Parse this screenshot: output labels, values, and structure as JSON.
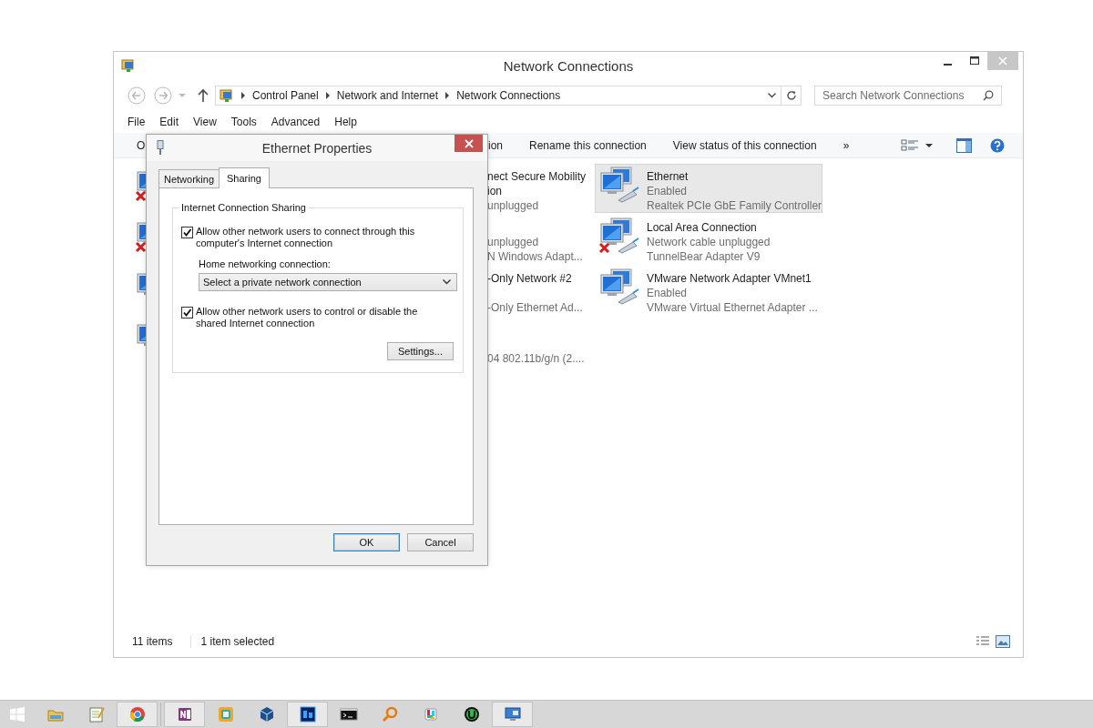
{
  "window": {
    "title": "Network Connections"
  },
  "address_bar": {
    "nav": [
      {
        "kind": "back",
        "disabled": true
      },
      {
        "kind": "forward",
        "disabled": true
      },
      {
        "kind": "recent",
        "disabled": true
      },
      {
        "kind": "up",
        "disabled": false
      }
    ],
    "breadcrumbs": [
      "Control Panel",
      "Network and Internet",
      "Network Connections"
    ],
    "search": {
      "placeholder": "Search Network Connections"
    }
  },
  "menu": [
    "File",
    "Edit",
    "View",
    "Tools",
    "Advanced",
    "Help"
  ],
  "toolbar": {
    "left": "O",
    "items": [
      "ion",
      "Rename this connection",
      "View status of this connection"
    ],
    "overflow": "»"
  },
  "adapter_column_1": [
    {
      "disconnected": true,
      "name": [
        "nect Secure Mobility",
        "ion"
      ],
      "status": "unplugged"
    },
    {
      "disconnected": true,
      "status": "unplugged",
      "device": "N Windows Adapt..."
    },
    {
      "disconnected": false,
      "name": [
        "-Only Network #2"
      ],
      "device": "-Only Ethernet Ad..."
    },
    {
      "disconnected": false,
      "device": "04 802.11b/g/n (2...."
    }
  ],
  "adapter_column_2": [
    {
      "name": "Ethernet",
      "status": "Enabled",
      "device": "Realtek PCIe GbE Family Controller",
      "selected": true,
      "disconnected": false
    },
    {
      "name": "Local Area Connection",
      "status": "Network cable unplugged",
      "device": "TunnelBear Adapter V9",
      "selected": false,
      "disconnected": true
    },
    {
      "name": "VMware Network Adapter VMnet1",
      "status": "Enabled",
      "device": "VMware Virtual Ethernet Adapter ...",
      "selected": false,
      "disconnected": false
    }
  ],
  "status_bar": {
    "item_count": "11 items",
    "selection": "1 item selected"
  },
  "dialog": {
    "title": "Ethernet Properties",
    "tabs": [
      {
        "label": "Networking",
        "selected": false
      },
      {
        "label": "Sharing",
        "selected": true
      }
    ],
    "group_title": "Internet Connection Sharing",
    "allow_connect": {
      "label": "Allow other network users to connect through this computer's Internet connection",
      "checked": true
    },
    "home_label": "Home networking connection:",
    "home_select": {
      "value": "Select a private network connection"
    },
    "allow_control": {
      "label": "Allow other network users to control or disable the shared Internet connection",
      "checked": true
    },
    "settings_button": "Settings...",
    "buttons": [
      {
        "label": "OK",
        "default": true
      },
      {
        "label": "Cancel",
        "default": false
      }
    ]
  },
  "taskbar": {
    "apps": [
      {
        "kind": "folder",
        "running": false
      },
      {
        "kind": "notepad",
        "running": false
      },
      {
        "kind": "wheel",
        "running": true
      },
      {
        "kind": "note",
        "running": true
      },
      {
        "kind": "frame",
        "running": false
      },
      {
        "kind": "cube",
        "running": false
      },
      {
        "kind": "tile",
        "running": true
      },
      {
        "kind": "terminal",
        "running": false
      },
      {
        "kind": "magnifier",
        "running": false
      },
      {
        "kind": "pinwheel",
        "running": false
      },
      {
        "kind": "circle",
        "running": false
      },
      {
        "kind": "monitor",
        "running": true
      }
    ]
  }
}
